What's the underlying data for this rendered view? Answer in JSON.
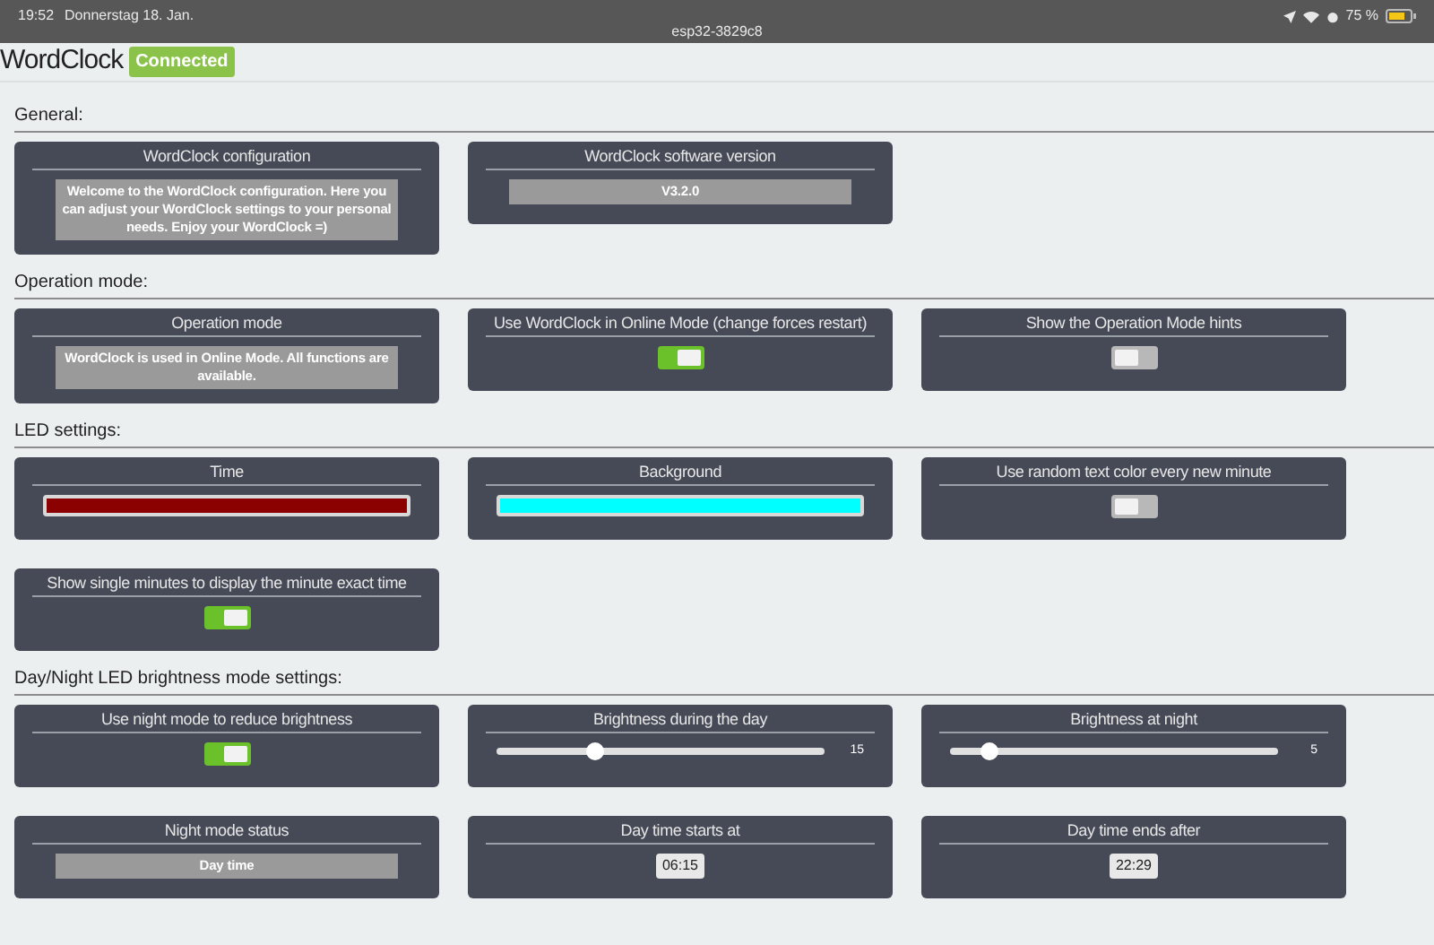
{
  "status_bar": {
    "time": "19:52",
    "date": "Donnerstag 18. Jan.",
    "host": "esp32-3829c8",
    "battery": "75 %"
  },
  "header": {
    "title": "WordClock",
    "badge": "Connected"
  },
  "sections": [
    {
      "title": "General:",
      "cards": [
        {
          "kind": "text",
          "title": "WordClock configuration",
          "text": "Welcome to the WordClock configuration. Here you can adjust your WordClock settings to your personal needs. Enjoy your WordClock =)"
        },
        {
          "kind": "text",
          "title": "WordClock software version",
          "text": "V3.2.0"
        }
      ]
    },
    {
      "title": "Operation mode:",
      "cards": [
        {
          "kind": "text",
          "title": "Operation mode",
          "text": "WordClock is used in Online Mode. All functions are available."
        },
        {
          "kind": "toggle",
          "title": "Use WordClock in Online Mode (change forces restart)",
          "on": true
        },
        {
          "kind": "toggle",
          "title": "Show the Operation Mode hints",
          "on": false
        }
      ]
    },
    {
      "title": "LED settings:",
      "cards": [
        {
          "kind": "color",
          "title": "Time",
          "color": "#8b0000"
        },
        {
          "kind": "color",
          "title": "Background",
          "color": "#00ffff"
        },
        {
          "kind": "toggle",
          "title": "Use random text color every new minute",
          "on": false
        },
        {
          "kind": "toggle",
          "title": "Show single minutes to display the minute exact time",
          "on": true
        }
      ]
    },
    {
      "title": "Day/Night LED brightness mode settings:",
      "cards": [
        {
          "kind": "toggle",
          "title": "Use night mode to reduce brightness",
          "on": true
        },
        {
          "kind": "slider",
          "title": "Brightness during the day",
          "level": 0.3,
          "reading": "15"
        },
        {
          "kind": "slider",
          "title": "Brightness at night",
          "level": 0.12,
          "reading": "5"
        },
        {
          "kind": "text",
          "title": "Night mode status",
          "text": "Day time"
        },
        {
          "kind": "time",
          "title": "Day time starts at",
          "value": "06:15"
        },
        {
          "kind": "time",
          "title": "Day time ends after",
          "value": "22:29"
        }
      ]
    }
  ]
}
